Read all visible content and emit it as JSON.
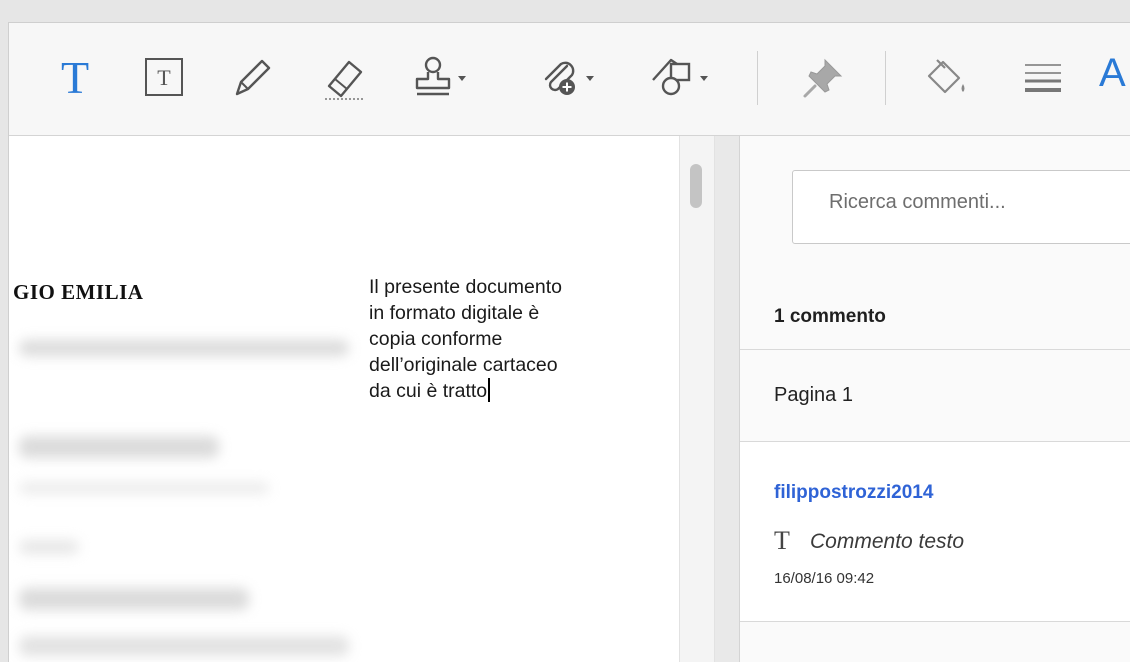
{
  "toolbar": {
    "text_tool_glyph": "T",
    "textbox_tool_glyph": "T",
    "cut_label": "A",
    "tools": [
      {
        "name": "add-text-comment",
        "icon": "text-t-icon"
      },
      {
        "name": "add-text-box",
        "icon": "textbox-icon"
      },
      {
        "name": "draw-free-form",
        "icon": "pencil-icon"
      },
      {
        "name": "erase-free-form",
        "icon": "eraser-icon"
      },
      {
        "name": "add-stamp",
        "icon": "stamp-icon"
      },
      {
        "name": "attach-file",
        "icon": "paperclip-plus-icon"
      },
      {
        "name": "drawing-tools",
        "icon": "shapes-icon"
      },
      {
        "name": "pin",
        "icon": "pushpin-icon"
      },
      {
        "name": "fill-color",
        "icon": "paint-bucket-icon"
      },
      {
        "name": "line-width",
        "icon": "line-width-icon"
      }
    ],
    "accent_color": "#2a7ad6"
  },
  "document": {
    "heading": "GIO EMILIA",
    "note_lines": [
      "Il presente documento",
      "in formato digitale è",
      "copia conforme",
      "dell’originale cartaceo",
      "da cui è tratto"
    ]
  },
  "comments": {
    "search_placeholder": "Ricerca commenti...",
    "count_label": "1 commento",
    "page_label": "Pagina 1",
    "items": [
      {
        "author": "filippostrozzi2014",
        "type_icon": "T",
        "type_label": "Commento testo",
        "timestamp": "16/08/16  09:42"
      }
    ],
    "author_color": "#2f63d6"
  }
}
